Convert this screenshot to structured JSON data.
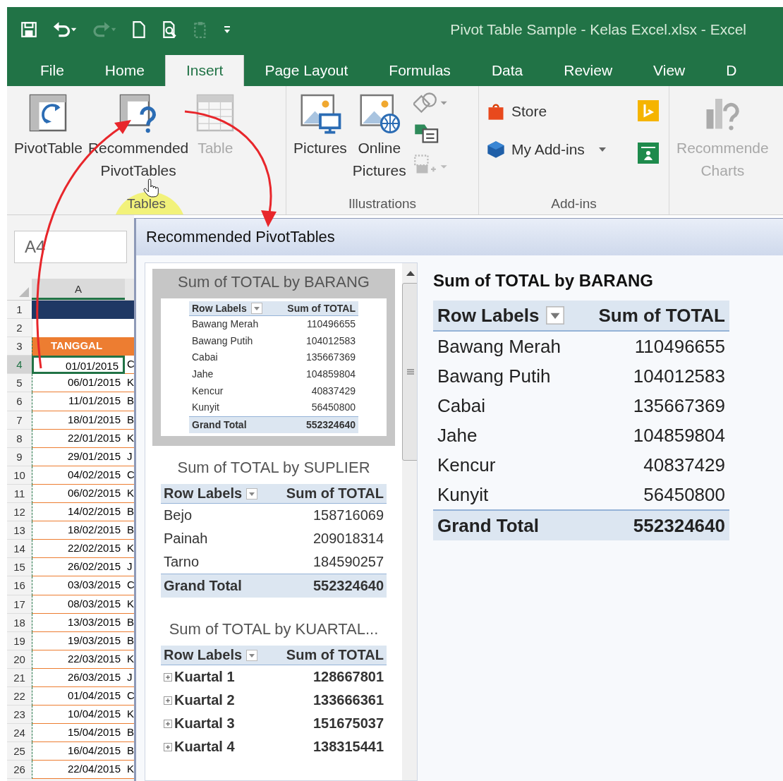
{
  "window": {
    "title": "Pivot Table Sample - Kelas Excel.xlsx - Excel"
  },
  "tabs": [
    {
      "label": "File",
      "selected": false
    },
    {
      "label": "Home",
      "selected": false
    },
    {
      "label": "Insert",
      "selected": true
    },
    {
      "label": "Page Layout",
      "selected": false
    },
    {
      "label": "Formulas",
      "selected": false
    },
    {
      "label": "Data",
      "selected": false
    },
    {
      "label": "Review",
      "selected": false
    },
    {
      "label": "View",
      "selected": false
    },
    {
      "label": "D",
      "selected": false
    }
  ],
  "ribbon_groups": [
    {
      "label": "Tables",
      "kind": "tables",
      "buttons": [
        {
          "lines": [
            "PivotTable"
          ],
          "disabled": false
        },
        {
          "lines": [
            "Recommended",
            "PivotTables"
          ],
          "disabled": false
        },
        {
          "lines": [
            "Table"
          ],
          "disabled": true
        }
      ]
    },
    {
      "label": "Illustrations",
      "kind": "illustrations",
      "buttons": [
        {
          "lines": [
            "Pictures"
          ],
          "disabled": false
        },
        {
          "lines": [
            "Online",
            "Pictures"
          ],
          "disabled": false
        }
      ]
    },
    {
      "label": "Add-ins",
      "kind": "addins",
      "buttons": [
        {
          "lines": [
            "Store"
          ],
          "disabled": false
        },
        {
          "lines": [
            "My Add-ins"
          ],
          "disabled": false
        }
      ]
    },
    {
      "kind": "charts",
      "buttons": [
        {
          "lines": [
            "Recommende",
            "Charts"
          ],
          "disabled": true
        }
      ]
    }
  ],
  "sheet": {
    "name_box": "A4",
    "column": "A",
    "rows": [
      {
        "num": "1",
        "kind": "band",
        "selected": false
      },
      {
        "num": "2",
        "kind": "blank",
        "selected": false
      },
      {
        "num": "3",
        "kind": "header",
        "a": "TANGGAL",
        "selected": false
      },
      {
        "num": "4",
        "kind": "data",
        "a": "01/01/2015",
        "b": "C",
        "selected": true
      },
      {
        "num": "5",
        "kind": "data",
        "a": "06/01/2015",
        "b": "K",
        "selected": false
      },
      {
        "num": "6",
        "kind": "data",
        "a": "11/01/2015",
        "b": "B",
        "selected": false
      },
      {
        "num": "7",
        "kind": "data",
        "a": "18/01/2015",
        "b": "B",
        "selected": false
      },
      {
        "num": "8",
        "kind": "data",
        "a": "22/01/2015",
        "b": "K",
        "selected": false
      },
      {
        "num": "9",
        "kind": "data",
        "a": "29/01/2015",
        "b": "J",
        "selected": false
      },
      {
        "num": "10",
        "kind": "data",
        "a": "04/02/2015",
        "b": "C",
        "selected": false
      },
      {
        "num": "11",
        "kind": "data",
        "a": "06/02/2015",
        "b": "K",
        "selected": false
      },
      {
        "num": "12",
        "kind": "data",
        "a": "14/02/2015",
        "b": "B",
        "selected": false
      },
      {
        "num": "13",
        "kind": "data",
        "a": "18/02/2015",
        "b": "B",
        "selected": false
      },
      {
        "num": "14",
        "kind": "data",
        "a": "22/02/2015",
        "b": "K",
        "selected": false
      },
      {
        "num": "15",
        "kind": "data",
        "a": "26/02/2015",
        "b": "J",
        "selected": false
      },
      {
        "num": "16",
        "kind": "data",
        "a": "03/03/2015",
        "b": "C",
        "selected": false
      },
      {
        "num": "17",
        "kind": "data",
        "a": "08/03/2015",
        "b": "K",
        "selected": false
      },
      {
        "num": "18",
        "kind": "data",
        "a": "13/03/2015",
        "b": "B",
        "selected": false
      },
      {
        "num": "19",
        "kind": "data",
        "a": "19/03/2015",
        "b": "B",
        "selected": false
      },
      {
        "num": "20",
        "kind": "data",
        "a": "22/03/2015",
        "b": "K",
        "selected": false
      },
      {
        "num": "21",
        "kind": "data",
        "a": "26/03/2015",
        "b": "J",
        "selected": false
      },
      {
        "num": "22",
        "kind": "data",
        "a": "01/04/2015",
        "b": "C",
        "selected": false
      },
      {
        "num": "23",
        "kind": "data",
        "a": "10/04/2015",
        "b": "K",
        "selected": false
      },
      {
        "num": "24",
        "kind": "data",
        "a": "15/04/2015",
        "b": "B",
        "selected": false
      },
      {
        "num": "25",
        "kind": "data",
        "a": "16/04/2015",
        "b": "B",
        "selected": false
      },
      {
        "num": "26",
        "kind": "data",
        "a": "22/04/2015",
        "b": "K",
        "selected": false
      }
    ]
  },
  "dialog": {
    "title": "Recommended PivotTables",
    "options": [
      {
        "title": "Sum of TOTAL by BARANG",
        "selected": true,
        "columns": [
          "Row Labels",
          "Sum of TOTAL"
        ],
        "rows": [
          {
            "label": "Bawang Merah",
            "value": "110496655"
          },
          {
            "label": "Bawang Putih",
            "value": "104012583"
          },
          {
            "label": "Cabai",
            "value": "135667369"
          },
          {
            "label": "Jahe",
            "value": "104859804"
          },
          {
            "label": "Kencur",
            "value": "40837429"
          },
          {
            "label": "Kunyit",
            "value": "56450800"
          }
        ],
        "total": {
          "label": "Grand Total",
          "value": "552324640"
        }
      },
      {
        "title": "Sum of TOTAL by SUPLIER",
        "selected": false,
        "columns": [
          "Row Labels",
          "Sum of TOTAL"
        ],
        "rows": [
          {
            "label": "Bejo",
            "value": "158716069"
          },
          {
            "label": "Painah",
            "value": "209018314"
          },
          {
            "label": "Tarno",
            "value": "184590257"
          }
        ],
        "total": {
          "label": "Grand Total",
          "value": "552324640"
        }
      },
      {
        "title": "Sum of TOTAL by KUARTAL...",
        "selected": false,
        "columns": [
          "Row Labels",
          "Sum of TOTAL"
        ],
        "rows": [
          {
            "label": "Kuartal 1",
            "value": "128667801",
            "expandable": true
          },
          {
            "label": "Kuartal 2",
            "value": "133666361",
            "expandable": true
          },
          {
            "label": "Kuartal 3",
            "value": "151675037",
            "expandable": true
          },
          {
            "label": "Kuartal 4",
            "value": "138315441",
            "expandable": true
          }
        ]
      }
    ],
    "preview": {
      "title": "Sum of TOTAL by BARANG",
      "columns": [
        "Row Labels",
        "Sum of TOTAL"
      ],
      "rows": [
        {
          "label": "Bawang Merah",
          "value": "110496655"
        },
        {
          "label": "Bawang Putih",
          "value": "104012583"
        },
        {
          "label": "Cabai",
          "value": "135667369"
        },
        {
          "label": "Jahe",
          "value": "104859804"
        },
        {
          "label": "Kencur",
          "value": "40837429"
        },
        {
          "label": "Kunyit",
          "value": "56450800"
        }
      ],
      "total": {
        "label": "Grand Total",
        "value": "552324640"
      }
    }
  }
}
